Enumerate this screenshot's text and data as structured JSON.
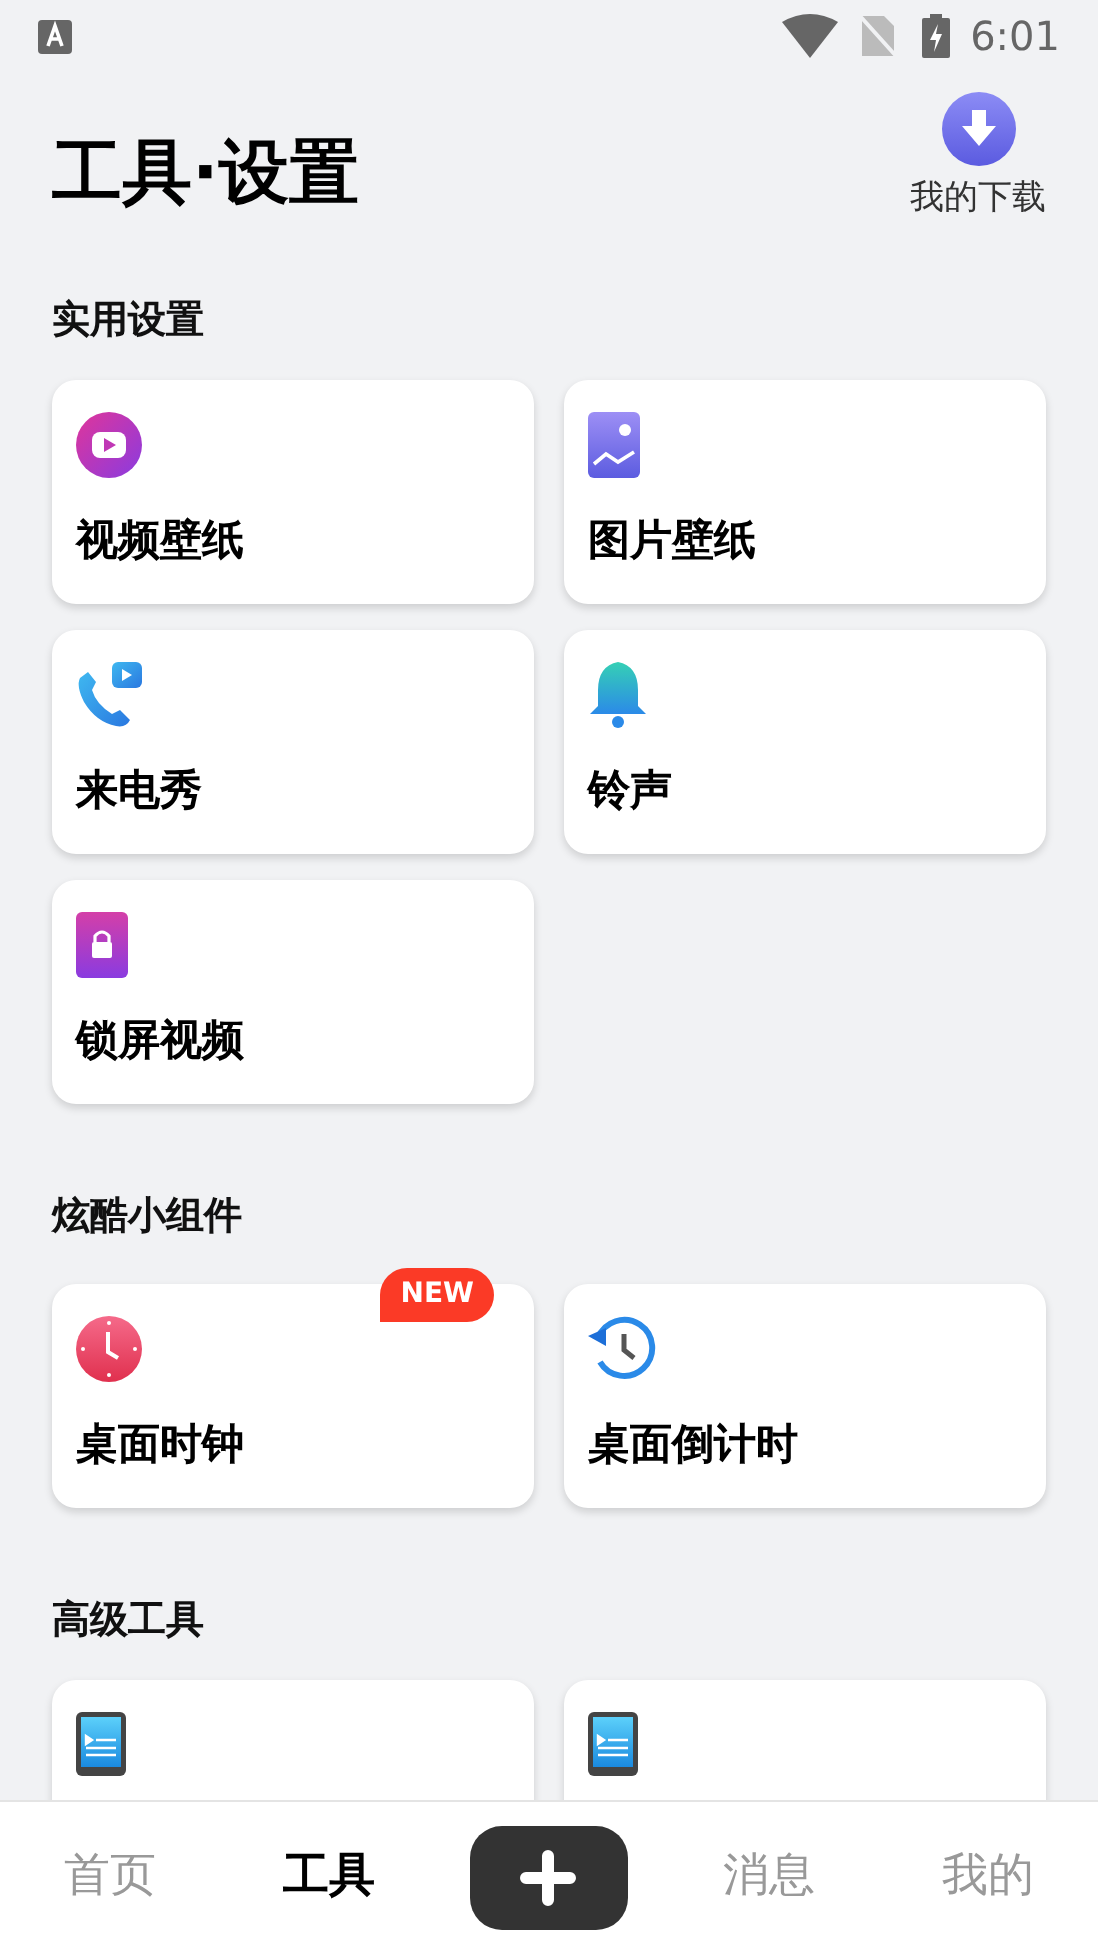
{
  "status_bar": {
    "time": "6:01"
  },
  "header": {
    "title": "工具·设置",
    "download": {
      "label": "我的下载"
    }
  },
  "sections": [
    {
      "title": "实用设置",
      "items": [
        {
          "label": "视频壁纸",
          "kind": "video"
        },
        {
          "label": "图片壁纸",
          "kind": "image"
        },
        {
          "label": "来电秀",
          "kind": "call"
        },
        {
          "label": "铃声",
          "kind": "bell"
        },
        {
          "label": "锁屏视频",
          "kind": "lock"
        }
      ]
    },
    {
      "title": "炫酷小组件",
      "items": [
        {
          "label": "桌面时钟",
          "kind": "clock",
          "badge": "NEW"
        },
        {
          "label": "桌面倒计时",
          "kind": "history"
        }
      ]
    },
    {
      "title": "高级工具",
      "items": [
        {
          "kind": "phone"
        },
        {
          "kind": "phone"
        }
      ]
    }
  ],
  "nav": [
    {
      "kind": "tab",
      "label": "首页",
      "selected": false
    },
    {
      "kind": "tab",
      "label": "工具",
      "selected": true
    },
    {
      "kind": "add"
    },
    {
      "kind": "tab",
      "label": "消息",
      "selected": false
    },
    {
      "kind": "tab",
      "label": "我的",
      "selected": false
    }
  ]
}
